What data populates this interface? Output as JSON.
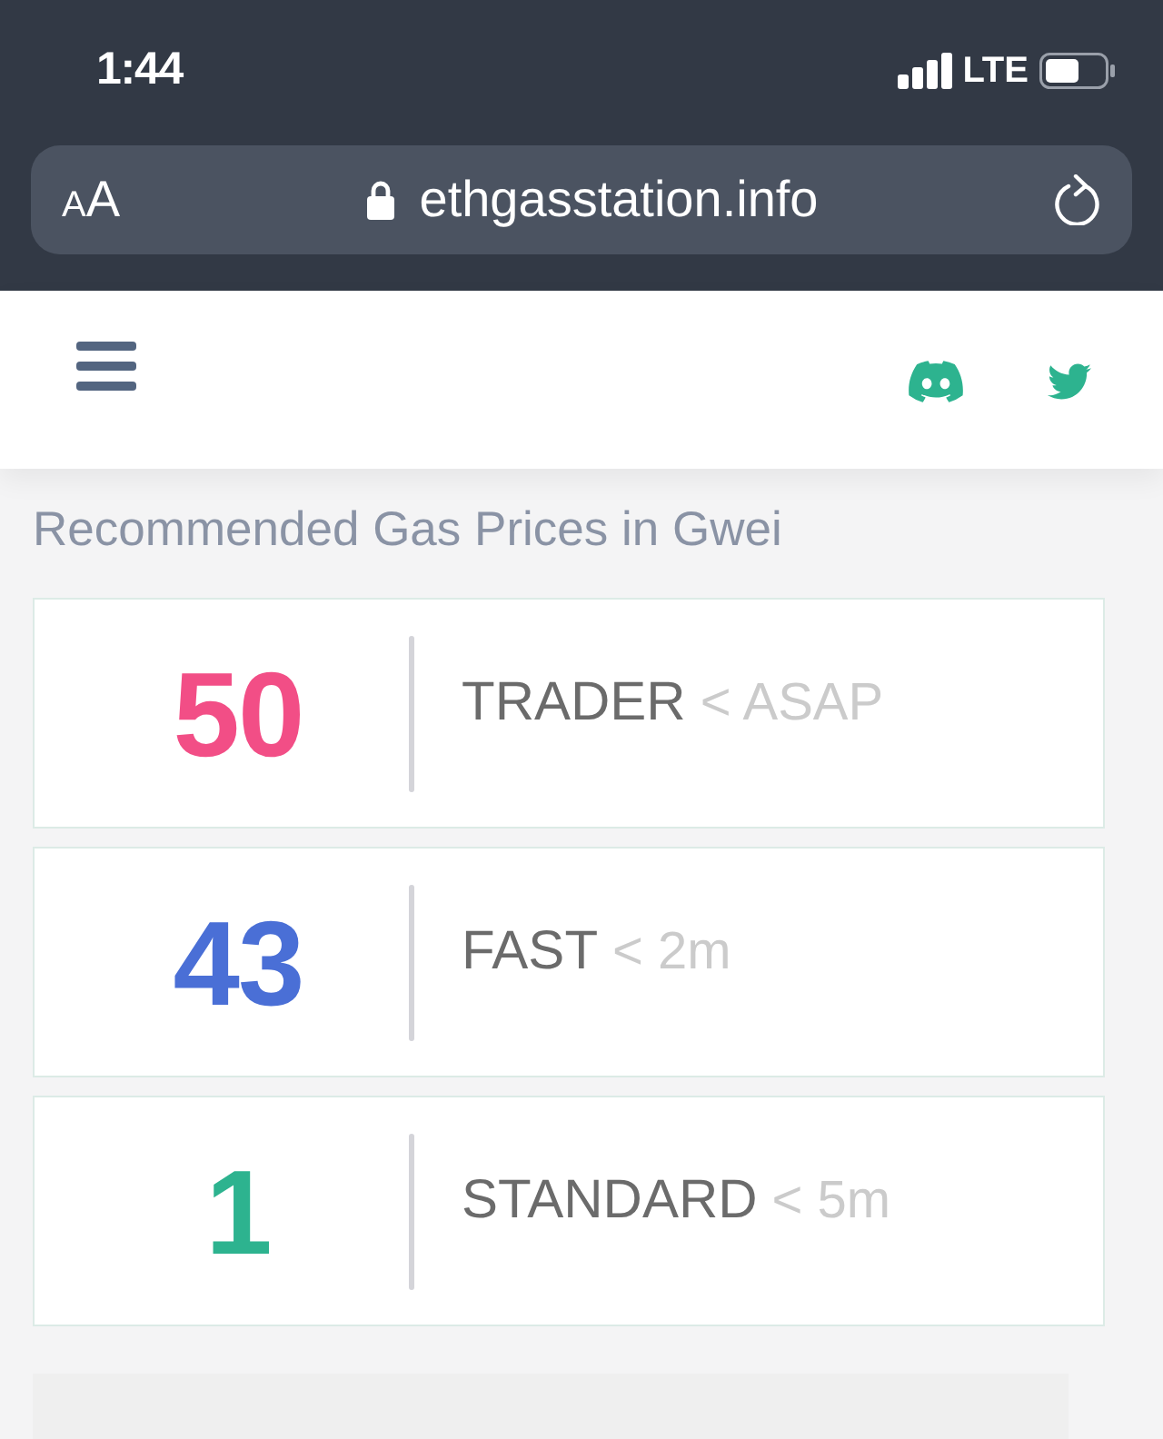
{
  "status_bar": {
    "time": "1:44",
    "network": "LTE"
  },
  "address_bar": {
    "text_size_button": "AA",
    "url": "ethgasstation.info"
  },
  "heading": "Recommended Gas Prices in Gwei",
  "prices": [
    {
      "value": "50",
      "label": "TRADER",
      "time": "< ASAP",
      "color": "#f24e86"
    },
    {
      "value": "43",
      "label": "FAST",
      "time": "< 2m",
      "color": "#4a6fd6"
    },
    {
      "value": "1",
      "label": "STANDARD",
      "time": "< 5m",
      "color": "#2db38f"
    }
  ]
}
